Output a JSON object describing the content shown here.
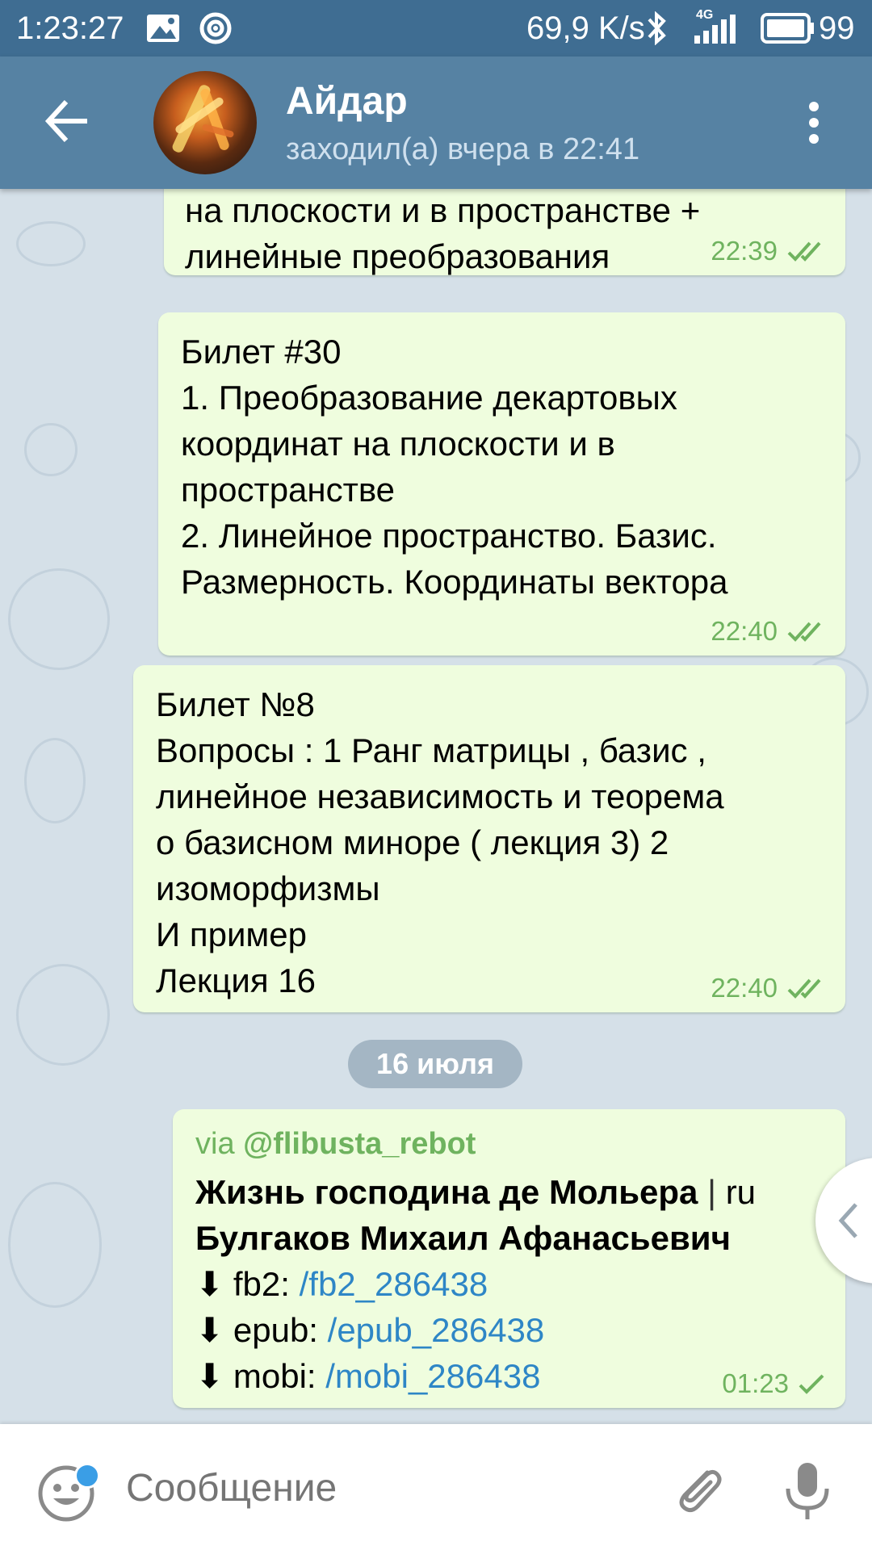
{
  "status_bar": {
    "time": "1:23:27",
    "speed": "69,9 K/s",
    "network": "4G",
    "battery": "99"
  },
  "header": {
    "contact_name": "Айдар",
    "contact_status": "заходил(а) вчера в 22:41"
  },
  "messages": [
    {
      "text": "на плоскости и в пространстве +\nлинейные преобразования",
      "time": "22:39"
    },
    {
      "text": "Билет #30\n1. Преобразование декартовых\nкоординат на плоскости и в\nпространстве\n2. Линейное пространство. Базис.\nРазмерность. Координаты вектора",
      "time": "22:40"
    },
    {
      "text": "Билет №8\nВопросы : 1 Ранг матрицы , базис ,\nлинейное независимость и теорема\nо базисном миноре ( лекция 3) 2\nизоморфизмы\nИ пример\nЛекция 16",
      "time": "22:40"
    }
  ],
  "date_separator": "16 июля",
  "bot_message": {
    "via_prefix": "via",
    "via_bot": "@flibusta_rebot",
    "title": "Жизнь господина де Мольера",
    "lang": "ru",
    "author": "Булгаков Михаил Афанасьевич",
    "downloads": [
      {
        "label": "fb2:",
        "link": "/fb2_286438"
      },
      {
        "label": "epub:",
        "link": "/epub_286438"
      },
      {
        "label": "mobi:",
        "link": "/mobi_286438"
      }
    ],
    "time": "01:23"
  },
  "input": {
    "placeholder": "Сообщение"
  },
  "colors": {
    "header": "#5682a3",
    "status_bar": "#3f6d92",
    "bubble_out": "#effdde",
    "time_green": "#6fb35f",
    "link": "#2e86c6"
  }
}
